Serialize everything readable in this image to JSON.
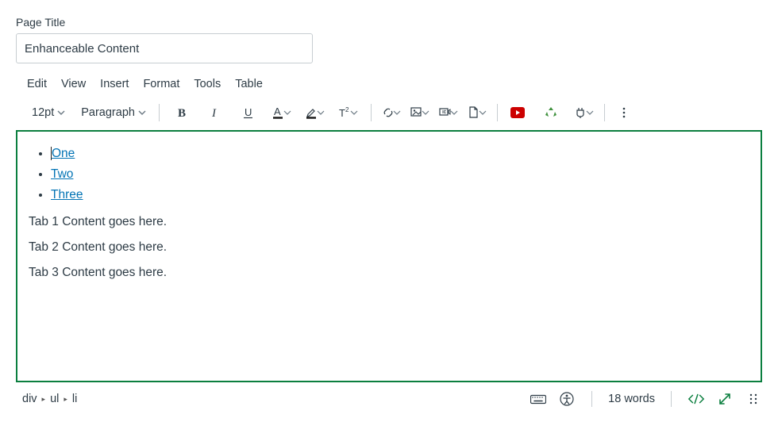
{
  "field": {
    "label": "Page Title",
    "value": "Enhanceable Content"
  },
  "menubar": {
    "edit": "Edit",
    "view": "View",
    "insert": "Insert",
    "format": "Format",
    "tools": "Tools",
    "table": "Table"
  },
  "toolbar": {
    "fontsize": "12pt",
    "blockformat": "Paragraph"
  },
  "content": {
    "list": [
      "One",
      "Two",
      "Three"
    ],
    "p1": "Tab 1 Content goes here.",
    "p2": "Tab 2 Content goes here.",
    "p3": "Tab 3 Content goes here."
  },
  "status": {
    "path1": "div",
    "path2": "ul",
    "path3": "li",
    "wordcount": "18 words"
  }
}
